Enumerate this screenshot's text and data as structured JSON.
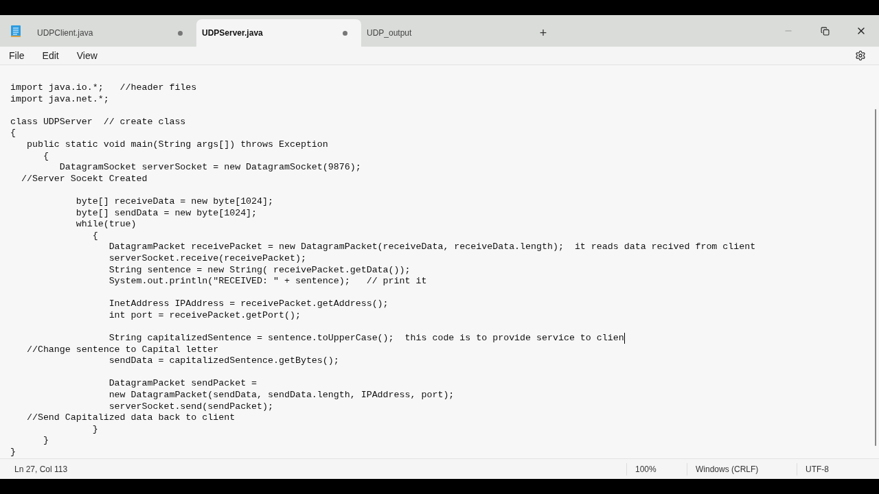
{
  "tabs": [
    {
      "label": "UDPClient.java",
      "selected": false,
      "modified": true
    },
    {
      "label": "UDPServer.java",
      "selected": true,
      "modified": true
    },
    {
      "label": "UDP_output",
      "selected": false,
      "modified": false
    }
  ],
  "new_tab": "+",
  "menu": [
    "File",
    "Edit",
    "View"
  ],
  "lines": [
    {
      "kind": "code",
      "text": "import java.io.*;   //header files"
    },
    {
      "kind": "code",
      "text": "import java.net.*;"
    },
    {
      "kind": "blank"
    },
    {
      "kind": "code",
      "text": "class UDPServer  // create class"
    },
    {
      "kind": "code",
      "text": "{"
    },
    {
      "kind": "code",
      "text": "   public static void main(String args[]) throws Exception"
    },
    {
      "kind": "code",
      "text": "      {"
    },
    {
      "kind": "code",
      "text": "         DatagramSocket serverSocket = new DatagramSocket(9876);"
    },
    {
      "kind": "code",
      "text": "  //Server Socekt Created"
    },
    {
      "kind": "blank"
    },
    {
      "kind": "code",
      "text": "            byte[] receiveData = new byte[1024];"
    },
    {
      "kind": "code",
      "text": "            byte[] sendData = new byte[1024];"
    },
    {
      "kind": "code",
      "text": "            while(true)"
    },
    {
      "kind": "code",
      "text": "               {"
    },
    {
      "kind": "code",
      "text": "                  DatagramPacket receivePacket = new DatagramPacket(receiveData, receiveData.length);  it reads data recived from client"
    },
    {
      "kind": "code",
      "text": "                  serverSocket.receive(receivePacket);"
    },
    {
      "kind": "code",
      "text": "                  String sentence = new String( receivePacket.getData());"
    },
    {
      "kind": "code",
      "text": "                  System.out.println(\"RECEIVED: \" + sentence);   // print it"
    },
    {
      "kind": "blank"
    },
    {
      "kind": "code",
      "text": "                  InetAddress IPAddress = receivePacket.getAddress();"
    },
    {
      "kind": "code",
      "text": "                  int port = receivePacket.getPort();"
    },
    {
      "kind": "blank"
    },
    {
      "kind": "code",
      "text": "                  String capitalizedSentence = sentence.toUpperCase();  this code is to provide service to clien",
      "cursor": true
    },
    {
      "kind": "code",
      "text": "   //Change sentence to Capital letter"
    },
    {
      "kind": "code",
      "text": "                  sendData = capitalizedSentence.getBytes();"
    },
    {
      "kind": "blank"
    },
    {
      "kind": "code",
      "text": "                  DatagramPacket sendPacket ="
    },
    {
      "kind": "code",
      "text": "                  new DatagramPacket(sendData, sendData.length, IPAddress, port);"
    },
    {
      "kind": "code",
      "text": "                  serverSocket.send(sendPacket);"
    },
    {
      "kind": "code",
      "text": "   //Send Capitalized data back to client"
    },
    {
      "kind": "code",
      "text": "               }"
    },
    {
      "kind": "code",
      "text": "      }"
    },
    {
      "kind": "code",
      "text": "}"
    }
  ],
  "status_bar": {
    "position": "Ln 27, Col 113",
    "zoom": "100%",
    "line_ending": "Windows (CRLF)",
    "encoding": "UTF-8"
  }
}
